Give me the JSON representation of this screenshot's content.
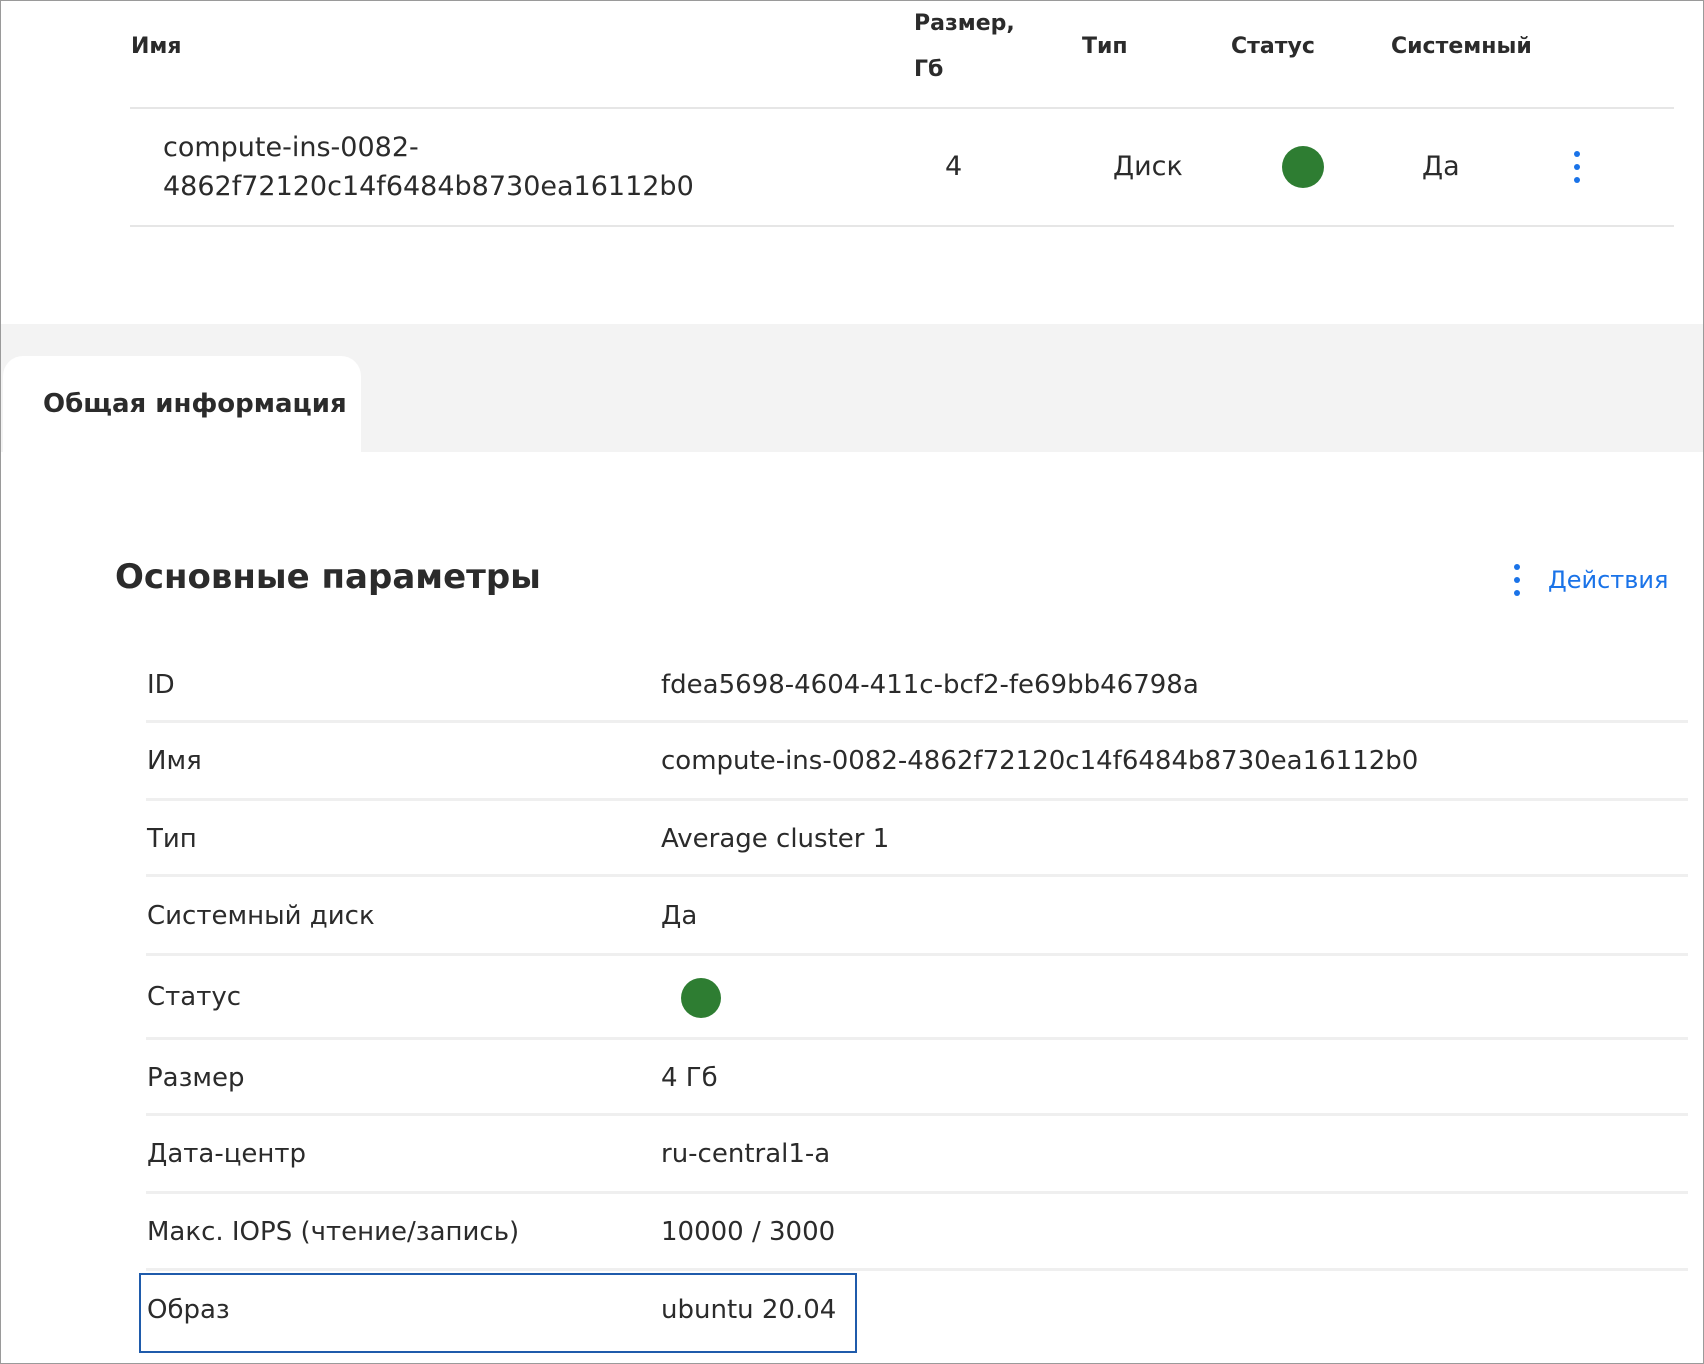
{
  "disks_table": {
    "headers": {
      "name": "Имя",
      "size_line1": "Размер,",
      "size_line2": "Гб",
      "type": "Тип",
      "status": "Статус",
      "system": "Системный"
    },
    "rows": [
      {
        "name_line1": "compute-ins-0082-",
        "name_line2": "4862f72120c14f6484b8730ea16112b0",
        "size": "4",
        "type": "Диск",
        "status": "active",
        "system": "Да"
      }
    ]
  },
  "tabs": [
    {
      "label": "Общая информация",
      "active": true
    }
  ],
  "section": {
    "title": "Основные параметры",
    "actions_label": "Действия"
  },
  "properties": [
    {
      "key": "ID",
      "value": "fdea5698-4604-411c-bcf2-fe69bb46798a"
    },
    {
      "key": "Имя",
      "value": "compute-ins-0082-4862f72120c14f6484b8730ea16112b0"
    },
    {
      "key": "Тип",
      "value": "Average cluster 1"
    },
    {
      "key": "Системный диск",
      "value": "Да"
    },
    {
      "key": "Статус",
      "value": ""
    },
    {
      "key": "Размер",
      "value": "4 Гб"
    },
    {
      "key": "Дата-центр",
      "value": "ru-central1-a"
    },
    {
      "key": "Макс. IOPS (чтение/запись)",
      "value": "10000 / 3000"
    },
    {
      "key": "Образ",
      "value": "ubuntu 20.04"
    }
  ],
  "colors": {
    "status_ok": "#2e7d32",
    "accent": "#1a73e8",
    "highlight_border": "#1f5bab"
  },
  "icons": {
    "row_menu": "more-vertical-icon",
    "actions_menu": "more-vertical-icon",
    "status": "status-dot-icon"
  }
}
